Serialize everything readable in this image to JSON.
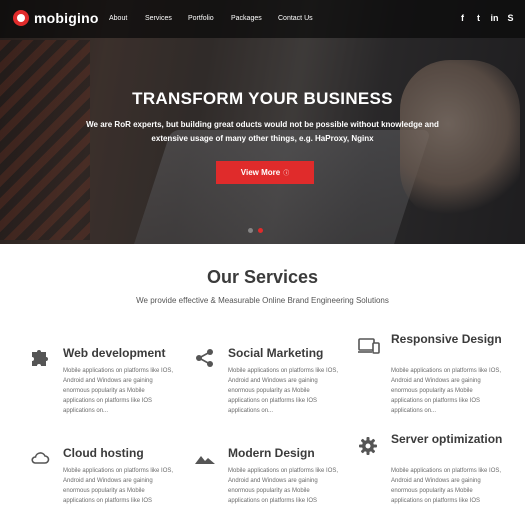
{
  "brand": {
    "name": "mobigino"
  },
  "nav": {
    "items": [
      {
        "label": "About",
        "has_dropdown": true
      },
      {
        "label": "Services",
        "has_dropdown": true
      },
      {
        "label": "Portfolio",
        "has_dropdown": true
      },
      {
        "label": "Packages",
        "has_dropdown": false
      },
      {
        "label": "Contact Us",
        "has_dropdown": false
      }
    ],
    "social": [
      {
        "glyph": "f",
        "icon": "facebook-icon"
      },
      {
        "glyph": "t",
        "icon": "twitter-icon"
      },
      {
        "glyph": "in",
        "icon": "linkedin-icon"
      },
      {
        "glyph": "S",
        "icon": "skype-icon"
      }
    ]
  },
  "hero": {
    "title": "TRANSFORM YOUR BUSINESS",
    "subtitle": "We are RoR experts, but building great oducts would not be possible without knowledge and extensive usage of many other things, e.g. HaProxy, Nginx",
    "cta_label": "View More",
    "cta_icon": "arrow-circle-icon",
    "slides": 2,
    "active_slide": 2
  },
  "services": {
    "title": "Our Services",
    "subtitle": "We provide effective & Measurable Online Brand Engineering Solutions",
    "items": [
      {
        "title": "Web development",
        "icon": "puzzle-icon",
        "text": "Mobile applications on platforms like IOS, Android and Windows are gaining enormous popularity as Mobile applications on platforms like IOS applications on..."
      },
      {
        "title": "Social Marketing",
        "icon": "share-icon",
        "text": "Mobile applications on platforms like IOS, Android and Windows are gaining enormous popularity as Mobile applications on platforms like IOS applications on..."
      },
      {
        "title": "Responsive Design",
        "icon": "devices-icon",
        "text": "Mobile applications on platforms like IOS, Android and Windows are gaining enormous popularity as Mobile applications on platforms like IOS applications on..."
      },
      {
        "title": "Cloud hosting",
        "icon": "cloud-icon",
        "text": "Mobile applications on platforms like IOS, Android and Windows are gaining enormous popularity as Mobile applications on platforms like IOS"
      },
      {
        "title": "Modern Design",
        "icon": "mountains-icon",
        "text": "Mobile applications on platforms like IOS, Android and Windows are gaining enormous popularity as Mobile applications on platforms like IOS"
      },
      {
        "title": "Server optimization",
        "icon": "gear-icon",
        "text": "Mobile applications on platforms like IOS, Android and Windows are gaining enormous popularity as Mobile applications on platforms like IOS"
      }
    ]
  },
  "colors": {
    "accent": "#e02b2b",
    "nav_bg": "#111111",
    "text": "#3b3b3b"
  }
}
